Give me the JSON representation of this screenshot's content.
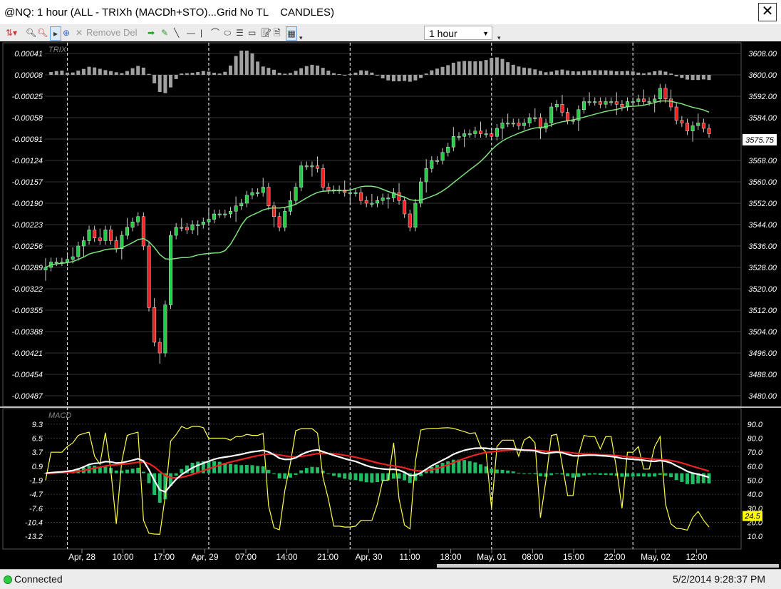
{
  "window": {
    "title": "@NQ: 1 hour (ALL - TRIXh (MACDh+STO)...Grid No TL    CANDLES)",
    "close_glyph": "✕"
  },
  "toolbar": {
    "remove_label": "Remove Del",
    "interval_value": "1 hour"
  },
  "status": {
    "connection": "Connected",
    "datetime": "5/2/2014 9:28:37 PM"
  },
  "colors": {
    "background": "#000000",
    "up_candle": "#22cc44",
    "down_candle": "#ee2222",
    "trix_bar": "#a0a0a0",
    "ma_line": "#7fe07f",
    "macd_hist": "#22bb66",
    "macd_line": "#ffffff",
    "signal_line": "#ee2222",
    "stoch_line": "#ffff44",
    "last_price_tag": "#ffffff",
    "stoch_tag": "#ffff00"
  },
  "chart_data": [
    {
      "type": "candlestick",
      "title": "",
      "indicator_label": "TRIX",
      "left_axis_ticks": [
        "0.00041",
        "0.00008",
        "-0.00025",
        "-0.00058",
        "-0.00091",
        "-0.00124",
        "-0.00157",
        "-0.00190",
        "-0.00223",
        "-0.00256",
        "-0.00289",
        "-0.00322",
        "-0.00355",
        "-0.00388",
        "-0.00421",
        "-0.00454",
        "-0.00487"
      ],
      "right_axis_ticks": [
        "3608.00",
        "3600.00",
        "3592.00",
        "3584.00",
        "3576.00",
        "3568.00",
        "3560.00",
        "3552.00",
        "3544.00",
        "3536.00",
        "3528.00",
        "3520.00",
        "3512.00",
        "3504.00",
        "3496.00",
        "3488.00",
        "3480.00"
      ],
      "ylim": [
        3476,
        3612
      ],
      "last_price": "3575.75",
      "closes": [
        3528,
        3530,
        3530,
        3530,
        3531,
        3532,
        3536,
        3538,
        3542,
        3539,
        3538,
        3542,
        3538,
        3535,
        3540,
        3543,
        3545,
        3547,
        3536,
        3513,
        3500,
        3496,
        3514,
        3540,
        3543,
        3543,
        3542,
        3544,
        3544,
        3545,
        3546,
        3548,
        3548,
        3548,
        3549,
        3551,
        3552,
        3555,
        3556,
        3556,
        3558,
        3551,
        3547,
        3543,
        3549,
        3553,
        3558,
        3566,
        3566,
        3566,
        3565,
        3558,
        3557,
        3557,
        3557,
        3556,
        3556,
        3556,
        3553,
        3552,
        3552,
        3553,
        3554,
        3554,
        3556,
        3553,
        3548,
        3543,
        3552,
        3560,
        3565,
        3568,
        3568,
        3571,
        3573,
        3577,
        3577,
        3578,
        3578,
        3579,
        3578,
        3578,
        3577,
        3580,
        3582,
        3582,
        3582,
        3581,
        3582,
        3584,
        3584,
        3580,
        3582,
        3588,
        3589,
        3586,
        3583,
        3583,
        3587,
        3590,
        3590,
        3590,
        3589,
        3590,
        3590,
        3589,
        3588,
        3590,
        3590,
        3591,
        3590,
        3590,
        3591,
        3595,
        3591,
        3588,
        3583,
        3582,
        3579,
        3581,
        3582,
        3580,
        3578
      ]
    },
    {
      "type": "line",
      "title": "",
      "indicator_label": "MACD",
      "left_axis_ticks": [
        "9.3",
        "6.5",
        "3.7",
        "0.9",
        "-1.9",
        "-4.7",
        "-7.6",
        "-10.4",
        "-13.2"
      ],
      "right_axis_ticks": [
        "90.0",
        "80.0",
        "70.0",
        "60.0",
        "50.0",
        "40.0",
        "30.0",
        "20.0",
        "10.0"
      ],
      "stoch_value_tag": "24.5",
      "series": []
    }
  ],
  "x_axis_labels": [
    "Apr, 28",
    "10:00",
    "17:00",
    "Apr, 29",
    "07:00",
    "14:00",
    "21:00",
    "Apr, 30",
    "11:00",
    "18:00",
    "May, 01",
    "08:00",
    "15:00",
    "22:00",
    "May, 02",
    "12:00"
  ]
}
